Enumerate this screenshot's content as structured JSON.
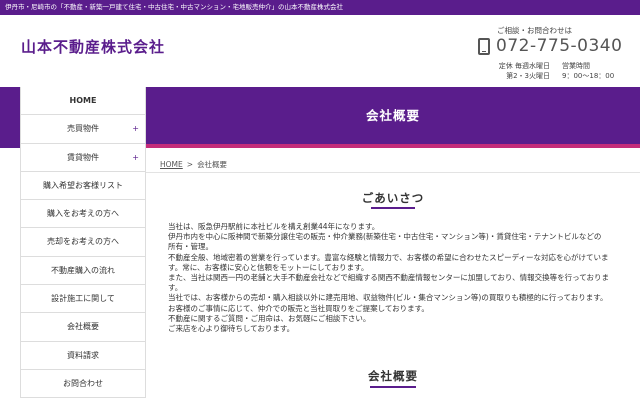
{
  "topbar": {
    "text": "伊丹市・尼崎市の「不動産・新築一戸建て住宅・中古住宅・中古マンション・宅地販売仲介」の山本不動産株式会社"
  },
  "header": {
    "logo": "山本不動産株式会社",
    "contact_label": "ご相談・お問合わせは",
    "phone": "072-775-0340",
    "hours": [
      {
        "left": "定休 毎週水曜日",
        "right": "営業時間"
      },
      {
        "left": "第2・3火曜日",
        "right": "9：00～18：00"
      }
    ]
  },
  "page": {
    "heading": "会社概要"
  },
  "breadcrumb": {
    "home": "HOME",
    "separator": ">",
    "current": "会社概要"
  },
  "sidebar": {
    "items": [
      {
        "label": "HOME",
        "plus": ""
      },
      {
        "label": "売買物件",
        "plus": "+"
      },
      {
        "label": "賃貸物件",
        "plus": "+"
      },
      {
        "label": "購入希望お客様リスト",
        "plus": ""
      },
      {
        "label": "購入をお考えの方へ",
        "plus": ""
      },
      {
        "label": "売却をお考えの方へ",
        "plus": ""
      },
      {
        "label": "不動産購入の流れ",
        "plus": ""
      },
      {
        "label": "設計施工に関して",
        "plus": ""
      },
      {
        "label": "会社概要",
        "plus": ""
      },
      {
        "label": "資料請求",
        "plus": ""
      },
      {
        "label": "お問合わせ",
        "plus": ""
      }
    ]
  },
  "greeting": {
    "title": "ごあいさつ",
    "lines": [
      "当社は、阪急伊丹駅前に本社ビルを構え創業44年になります。",
      "伊丹市内を中心に阪神間で新築分譲住宅の販売・仲介業務(新築住宅・中古住宅・マンション等)・賃貸住宅・テナントビルなどの",
      "所有・管理。",
      "不動産全般、地域密着の営業を行っています。豊富な経験と情報力で、お客様の希望に合わせたスピーディーな対応を心がけていま",
      "す。常に、お客様に安心と信頼をモットーにしております。",
      "また、当社は関西一円の老舗と大手不動産会社などで組織する関西不動産情報センターに加盟しており、情報交換等を行っておりま",
      "す。",
      "当社では、お客様からの売却・購入相談以外に建売用地、収益物件(ビル・集合マンション等)の買取りも積極的に行っております。",
      "お客様のご事情に応じて、仲介での販売と当社買取りをご提案しております。",
      "不動産に関するご質問・ご用命は、お気軽にご相談下さい。",
      "ご来店を心より御待ちしております。"
    ]
  },
  "company": {
    "title": "会社概要"
  },
  "colors": {
    "brand": "#5a1d8c",
    "accent": "#c52c7a"
  }
}
